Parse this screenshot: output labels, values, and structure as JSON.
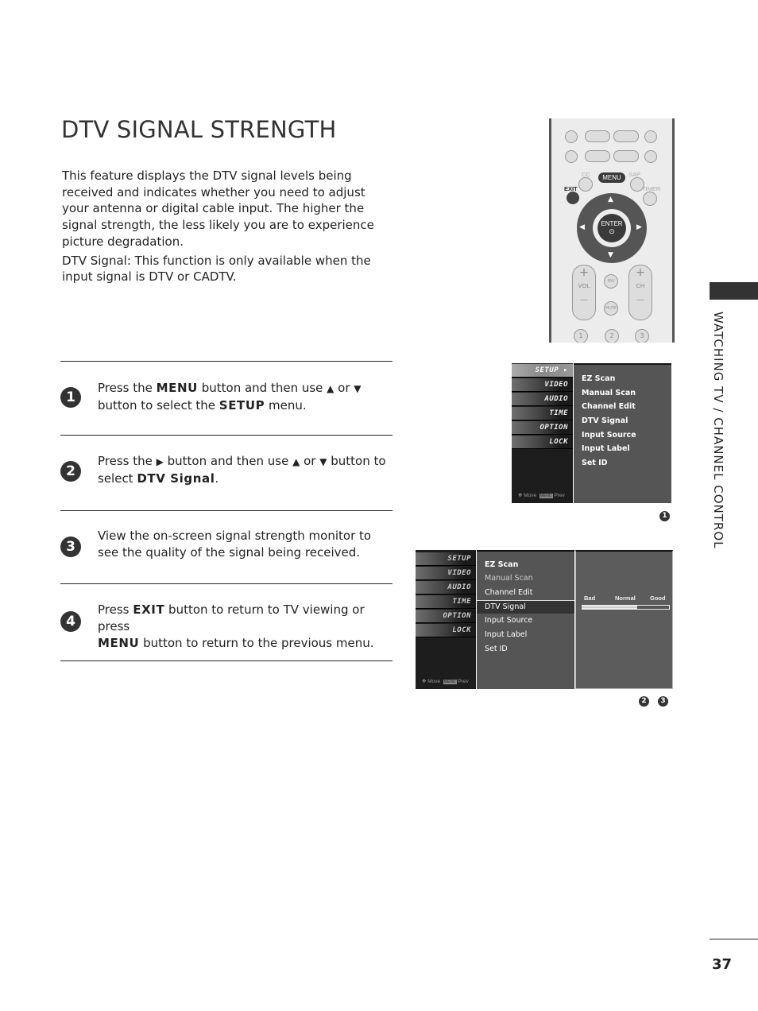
{
  "title": "DTV SIGNAL STRENGTH",
  "intro": [
    "This feature displays the DTV signal levels being received and indicates whether you need to adjust your antenna or digital cable input. The higher the signal strength, the less likely you are to experience picture degradation.",
    "DTV Signal: This function is only available when the input signal is DTV or CADTV."
  ],
  "steps": [
    {
      "num": "1",
      "parts": [
        "Press the ",
        "MENU",
        " button and then use ",
        "▲",
        " or ",
        "▼",
        " button to select the ",
        "SETUP",
        " menu."
      ]
    },
    {
      "num": "2",
      "parts": [
        "Press the ",
        "▶",
        " button and then use ",
        "▲",
        " or ",
        "▼",
        " button to select ",
        "DTV Signal",
        "."
      ]
    },
    {
      "num": "3",
      "parts": [
        "View the on-screen signal strength monitor to see the quality of the signal being received."
      ]
    },
    {
      "num": "4",
      "parts": [
        "Press ",
        "EXIT",
        " button to return to TV viewing or press ",
        "MENU",
        " button to return to the previous menu."
      ]
    }
  ],
  "remote": {
    "labels": {
      "cc": "CC",
      "menu": "MENU",
      "sap": "SAP",
      "exit": "EXIT",
      "timer": "TIMER",
      "enter": "ENTER",
      "vol": "VOL",
      "ch": "CH",
      "fav": "FAV",
      "mute": "MUTE",
      "plus": "+",
      "minus": "—"
    },
    "numbers": [
      "1",
      "2",
      "3"
    ],
    "icons": [
      "stop-icon",
      "play-icon",
      "pause-icon",
      "record-icon",
      "skip-back-icon",
      "rewind-icon",
      "fast-forward-icon",
      "skip-forward-icon"
    ]
  },
  "menu1": {
    "tabs": [
      "SETUP ▸",
      "VIDEO",
      "AUDIO",
      "TIME",
      "OPTION",
      "LOCK"
    ],
    "items": [
      "EZ Scan",
      "Manual Scan",
      "Channel Edit",
      "DTV Signal",
      "Input Source",
      "Input Label",
      "Set ID"
    ],
    "footer": {
      "move": "Move",
      "prev": "Prev",
      "menu_key": "MENU"
    },
    "badge": "1"
  },
  "menu2": {
    "tabs": [
      "SETUP",
      "VIDEO",
      "AUDIO",
      "TIME",
      "OPTION",
      "LOCK"
    ],
    "items": [
      "EZ Scan",
      "Manual Scan",
      "Channel Edit",
      "DTV Signal",
      "Input Source",
      "Input Label",
      "Set ID"
    ],
    "selected": "DTV Signal",
    "signal": {
      "labels": [
        "Bad",
        "Normal",
        "Good"
      ],
      "level_percent": 64
    },
    "footer": {
      "move": "Move",
      "prev": "Prev",
      "menu_key": "MENU"
    },
    "badges": [
      "2",
      "3"
    ]
  },
  "side_tab": "WATCHING TV / CHANNEL CONTROL",
  "page_number": "37"
}
